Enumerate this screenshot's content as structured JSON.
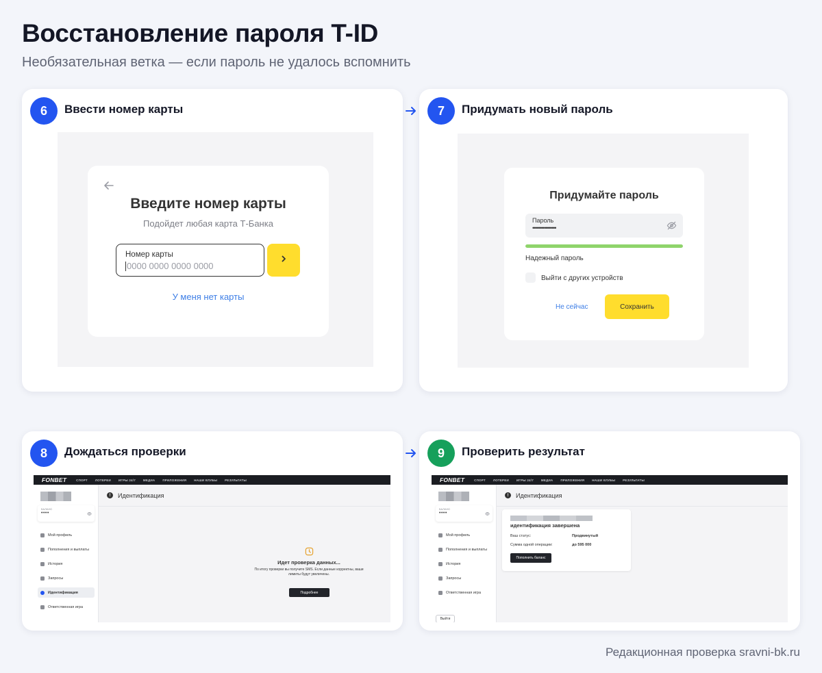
{
  "header": {
    "title": "Восстановление пароля T-ID",
    "subtitle": "Необязательная ветка — если пароль не удалось вспомнить"
  },
  "footer": {
    "credit": "Редакционная проверка sravni-bk.ru"
  },
  "colors": {
    "accent": "#2355f0",
    "success": "#16a05b",
    "yellow": "#ffdd2d"
  },
  "steps": [
    {
      "number": "6",
      "title": "Ввести номер карты",
      "screen": {
        "back_icon": "arrow-left-icon",
        "title": "Введите номер карты",
        "subtitle": "Подойдет любая карта Т-Банка",
        "input_label": "Номер карты",
        "input_placeholder": "0000 0000 0000 0000",
        "next_icon": "chevron-right-icon",
        "link": "У меня нет карты"
      }
    },
    {
      "number": "7",
      "title": "Придумать новый пароль",
      "screen": {
        "title": "Придумайте пароль",
        "password_label": "Пароль",
        "password_value": "••••••••••••••••",
        "strength_label": "Надежный пароль",
        "strength_level": 1.0,
        "checkbox_label": "Выйти с других устройств",
        "cancel_label": "Не сейчас",
        "save_label": "Сохранить"
      }
    },
    {
      "number": "8",
      "title": "Дождаться проверки",
      "screen": {
        "logo": "FONBET",
        "nav": [
          "СПОРТ",
          "ЛОТЕРЕИ",
          "ИГРЫ 24/7",
          "МЕДИА",
          "ПРИЛОЖЕНИЯ",
          "НАШИ КЛУБЫ",
          "РЕЗУЛЬТАТЫ"
        ],
        "balance_label": "БАЛАНС",
        "balance_value": "••••",
        "menu": [
          "Мой профиль",
          "Пополнения и выплаты",
          "История",
          "Запросы",
          "Идентификация",
          "Ответственная игра"
        ],
        "active_menu": "Идентификация",
        "page_heading": "Идентификация",
        "status_title": "Идет проверка данных...",
        "status_text": "По итогу проверки вы получите SMS. Если данные корректны, ваши лимиты будут увеличены.",
        "button": "Подробнее"
      }
    },
    {
      "number": "9",
      "title": "Проверить результат",
      "screen": {
        "logo": "FONBET",
        "nav": [
          "СПОРТ",
          "ЛОТЕРЕИ",
          "ИГРЫ 24/7",
          "МЕДИА",
          "ПРИЛОЖЕНИЯ",
          "НАШИ КЛУБЫ",
          "РЕЗУЛЬТАТЫ"
        ],
        "balance_label": "БАЛАНС",
        "balance_value": "••••",
        "menu": [
          "Мой профиль",
          "Пополнения и выплаты",
          "История",
          "Запросы",
          "Ответственная игра"
        ],
        "exit_label": "Выйти",
        "page_heading": "Идентификация",
        "result_title": "идентификация завершена",
        "status_key": "Ваш статус:",
        "status_value": "Продвинутый",
        "limit_key": "Сумма одной операции:",
        "limit_value": "до 595 000",
        "button": "Пополнить баланс"
      }
    }
  ]
}
